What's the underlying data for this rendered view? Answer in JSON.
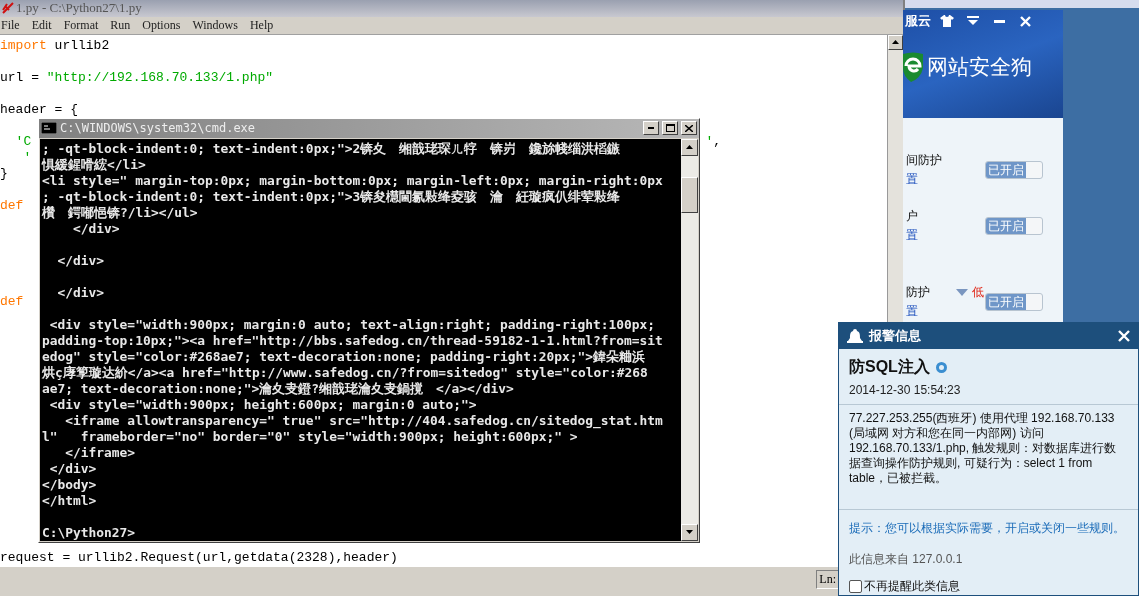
{
  "editor": {
    "title": "1.py - C:\\Python27\\1.py",
    "menu": [
      "File",
      "Edit",
      "Format",
      "Run",
      "Options",
      "Windows",
      "Help"
    ],
    "lines": [
      {
        "kind": "code",
        "tokens": [
          {
            "text": "import",
            "kind": "keyword"
          },
          {
            "text": " urllib2",
            "kind": "plain"
          }
        ]
      },
      {
        "kind": "blank"
      },
      {
        "kind": "code",
        "tokens": [
          {
            "text": "url = ",
            "kind": "plain"
          },
          {
            "text": "\"http://192.168.70.133/1.php\"",
            "kind": "string"
          }
        ]
      },
      {
        "kind": "blank"
      },
      {
        "kind": "code",
        "tokens": [
          {
            "text": "header = {",
            "kind": "plain"
          }
        ]
      },
      {
        "kind": "blank"
      },
      {
        "kind": "code",
        "tokens": [
          {
            "text": "  'C",
            "kind": "string"
          }
        ],
        "right_tokens": [
          {
            "text": "'",
            "kind": "string"
          },
          {
            "text": ",",
            "kind": "plain"
          }
        ]
      },
      {
        "kind": "code",
        "tokens": [
          {
            "text": "   '",
            "kind": "string"
          }
        ]
      },
      {
        "kind": "code",
        "tokens": [
          {
            "text": "}",
            "kind": "plain"
          }
        ]
      },
      {
        "kind": "blank"
      },
      {
        "kind": "code",
        "tokens": [
          {
            "text": "def",
            "kind": "keyword"
          }
        ]
      },
      {
        "kind": "blank"
      },
      {
        "kind": "blank"
      },
      {
        "kind": "blank"
      },
      {
        "kind": "blank"
      },
      {
        "kind": "blank"
      },
      {
        "kind": "code",
        "tokens": [
          {
            "text": "def",
            "kind": "keyword"
          }
        ]
      },
      {
        "kind": "blank"
      },
      {
        "kind": "blank"
      },
      {
        "kind": "blank"
      },
      {
        "kind": "blank"
      },
      {
        "kind": "blank"
      },
      {
        "kind": "blank"
      },
      {
        "kind": "blank"
      },
      {
        "kind": "blank"
      },
      {
        "kind": "blank"
      },
      {
        "kind": "blank"
      },
      {
        "kind": "blank"
      },
      {
        "kind": "blank"
      },
      {
        "kind": "blank"
      },
      {
        "kind": "blank"
      },
      {
        "kind": "blank"
      },
      {
        "kind": "code",
        "tokens": [
          {
            "text": "request = urllib2.Request(url,getdata(2328),header)",
            "kind": "plain"
          }
        ]
      }
    ],
    "status": "Ln:"
  },
  "cmd": {
    "title": "C:\\WINDOWS\\system32\\cmd.exe",
    "lines": [
      {
        "kind": "text",
        "text": "; -qt-block-indent:0; text-indent:0px;\">2锛夊　缃戠珯琛ㄦ牸　锛岃　鑱旀帴缁洪槄鏃"
      },
      {
        "kind": "text",
        "text": "惧緩鍟嗗綋</li>"
      },
      {
        "kind": "text",
        "text": "<li style=\" margin-top:0px; margin-bottom:0px; margin-left:0px; margin-right:0px"
      },
      {
        "kind": "text",
        "text": "; -qt-block-indent:0; text-indent:0px;\">3锛夋櫘閫氱敤绛夌骇　瀹　紝璇疯仈绯荤敤绛"
      },
      {
        "kind": "text",
        "text": "欑　鍔喐悒锛?/li></ul>"
      },
      {
        "kind": "text",
        "text": "    </div>"
      },
      {
        "kind": "blank"
      },
      {
        "kind": "text",
        "text": "  </div>"
      },
      {
        "kind": "blank"
      },
      {
        "kind": "text",
        "text": "  </div>"
      },
      {
        "kind": "blank"
      },
      {
        "kind": "text",
        "text": " <div style=\"width:900px; margin:0 auto; text-align:right; padding-right:100px;"
      },
      {
        "kind": "text",
        "text": "padding-top:10px;\"><a href=\"http://bbs.safedog.cn/thread-59182-1-1.html?from=sit"
      },
      {
        "kind": "text",
        "text": "edog\" style=\"color:#268ae7; text-decoration:none; padding-right:20px;\">鍏朵粬浜"
      },
      {
        "kind": "text",
        "text": "烘ç庨箰璇达紒</a><a href=\"http://www.safedog.cn/?from=sitedog\" style=\"color:#268"
      },
      {
        "kind": "text",
        "text": "ae7; text-decoration:none;\">瀹夊叏鐙?缃戠珯瀹夊叏鍋撹　</a></div>"
      },
      {
        "kind": "text",
        "text": " <div style=\"width:900px; height:600px; margin:0 auto;\">"
      },
      {
        "kind": "text",
        "text": "   <iframe allowtransparency=\" true\" src=\"http://404.safedog.cn/sitedog_stat.htm"
      },
      {
        "kind": "text",
        "text": "l\"   frameborder=\"no\" border=\"0\" style=\"width:900px; height:600px;\" >"
      },
      {
        "kind": "text",
        "text": "   </iframe>"
      },
      {
        "kind": "text",
        "text": " </div>"
      },
      {
        "kind": "text",
        "text": "</body>"
      },
      {
        "kind": "text",
        "text": "</html>"
      },
      {
        "kind": "blank"
      },
      {
        "kind": "text",
        "text": "C:\\Python27>"
      }
    ]
  },
  "safedog": {
    "title": "服云",
    "logo_text": "网站安全狗",
    "rows": [
      {
        "label": "间防护",
        "link": "置",
        "toggle": {
          "label": "已开启",
          "on": true
        }
      },
      {
        "label": "户",
        "link": "置",
        "toggle": {
          "label": "已开启",
          "on": true
        }
      },
      {
        "label": "防护",
        "grade": "低",
        "link": "置",
        "toggle": {
          "label": "已开启",
          "on": true
        }
      }
    ]
  },
  "alert": {
    "title": "报警信息",
    "heading": "防SQL注入",
    "date": "2014-12-30 15:54:23",
    "body": "77.227.253.255(西班牙) 使用代理 192.168.70.133 (局域网 对方和您在同一内部网) 访问 192.168.70.133/1.php, 触发规则：对数据库进行数据查询操作防护规则, 可疑行为：select 1 from table，已被拦截。",
    "hint": "提示：您可以根据实际需要，开启或关闭一些规则。",
    "source": "此信息来自 127.0.0.1",
    "dont_remind": {
      "label": "不再提醒此类信息",
      "checked": false
    }
  }
}
